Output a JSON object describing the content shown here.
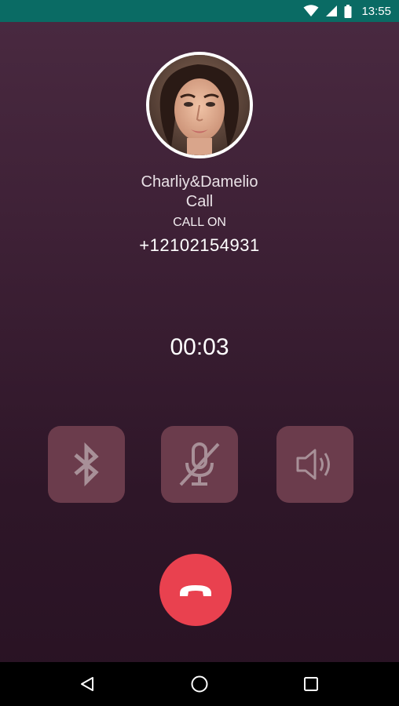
{
  "status_bar": {
    "time": "13:55",
    "icons": [
      "wifi-icon",
      "cellular-signal-icon",
      "battery-icon"
    ],
    "background": "#0a6b64"
  },
  "caller": {
    "name": "Charliy&Damelio",
    "call_label": "Call",
    "status": "CALL ON",
    "number": "+12102154931"
  },
  "call": {
    "duration": "00:03"
  },
  "actions": [
    {
      "icon": "bluetooth-icon"
    },
    {
      "icon": "microphone-muted-icon"
    },
    {
      "icon": "speaker-icon"
    }
  ],
  "end_call": {
    "icon": "phone-hangup-icon",
    "color": "#e9414f"
  },
  "navigation": {
    "buttons": [
      "back-icon",
      "home-icon",
      "recents-icon"
    ]
  },
  "colors": {
    "background_top": "#4a2a41",
    "background_bottom": "#281223",
    "action_button": "#6b3c4c"
  }
}
